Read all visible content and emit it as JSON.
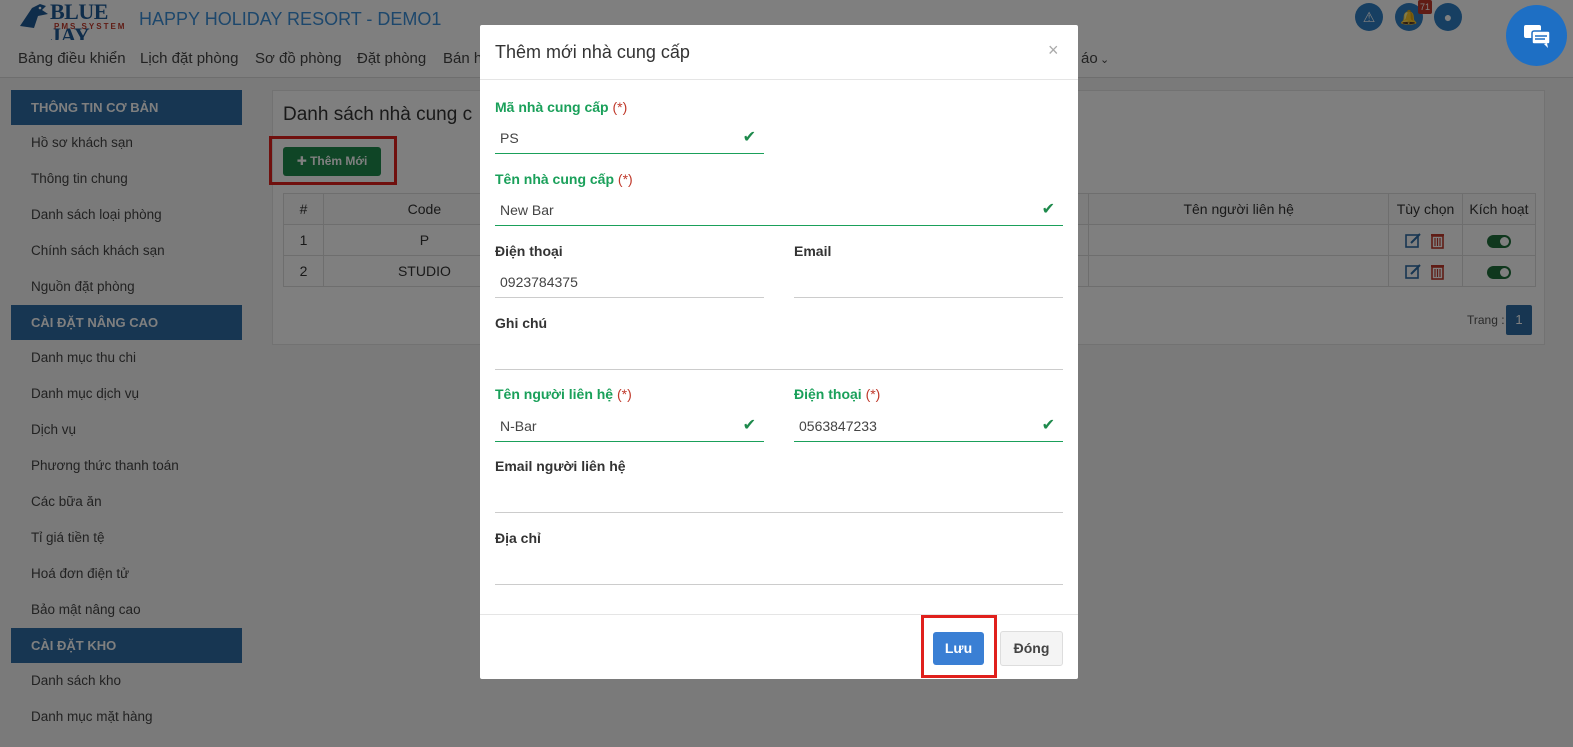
{
  "brand": {
    "logo_text": "BLUE JAY",
    "logo_sub": "PMS SYSTEM",
    "resort_name": "HAPPY HOLIDAY RESORT - DEMO1"
  },
  "header": {
    "notification_count": "71"
  },
  "nav": {
    "items": [
      "Bảng điều khiển",
      "Lịch đặt phòng",
      "Sơ đồ phòng",
      "Đặt phòng",
      "Bán h"
    ],
    "tail": "áo"
  },
  "sidebar": {
    "sections": [
      {
        "title": "THÔNG TIN CƠ BẢN",
        "items": [
          "Hồ sơ khách sạn",
          "Thông tin chung",
          "Danh sách loại phòng",
          "Chính sách khách sạn",
          "Nguồn đặt phòng"
        ]
      },
      {
        "title": "CÀI ĐẶT NÂNG CAO",
        "items": [
          "Danh mục thu chi",
          "Danh mục dịch vụ",
          "Dịch vụ",
          "Phương thức thanh toán",
          "Các bữa ăn",
          "Tỉ giá tiền tệ",
          "Hoá đơn điện tử",
          "Bảo mật nâng cao"
        ]
      },
      {
        "title": "CÀI ĐẶT KHO",
        "items": [
          "Danh sách kho",
          "Danh mục mặt hàng"
        ]
      }
    ]
  },
  "main": {
    "title": "Danh sách nhà cung c",
    "add_button": "Thêm Mới",
    "table": {
      "headers": [
        "#",
        "Code",
        "Tên người liên hệ",
        "Tùy chọn",
        "Kích hoạt"
      ],
      "rows": [
        {
          "num": "1",
          "code": "P"
        },
        {
          "num": "2",
          "code": "STUDIO"
        }
      ]
    },
    "pager": {
      "label": "Trang :",
      "page": "1"
    }
  },
  "modal": {
    "title": "Thêm mới nhà cung cấp",
    "close": "×",
    "required_mark": "(*)",
    "fields": {
      "supplier_code": {
        "label": "Mã nhà cung cấp",
        "value": "PS"
      },
      "supplier_name": {
        "label": "Tên nhà cung cấp",
        "value": "New Bar"
      },
      "phone": {
        "label": "Điện thoại",
        "value": "0923784375"
      },
      "email": {
        "label": "Email",
        "value": ""
      },
      "note": {
        "label": "Ghi chú",
        "value": ""
      },
      "contact_name": {
        "label": "Tên người liên hệ",
        "value": "N-Bar"
      },
      "contact_phone": {
        "label": "Điện thoại",
        "value": "0563847233"
      },
      "contact_email": {
        "label": "Email người liên hệ",
        "value": ""
      },
      "address": {
        "label": "Địa chỉ",
        "value": ""
      }
    },
    "save_button": "Lưu",
    "close_button": "Đóng"
  },
  "colors": {
    "primary": "#2e6da4",
    "success": "#1aa05a",
    "danger": "#e0201c"
  }
}
